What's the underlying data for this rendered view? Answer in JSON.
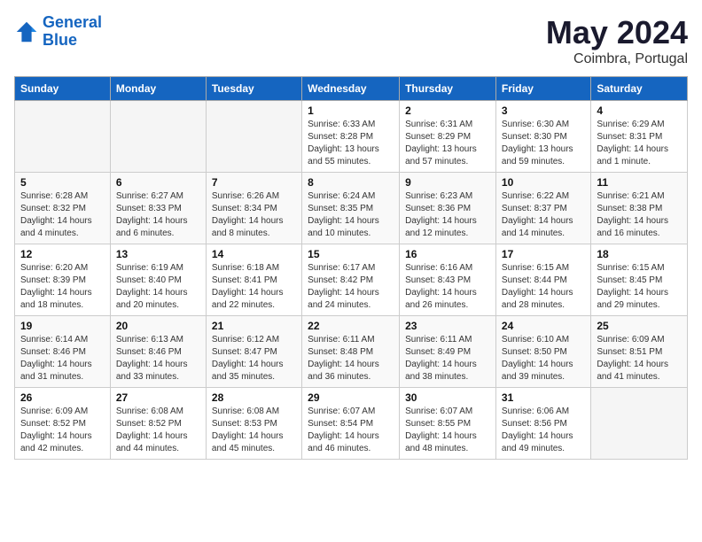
{
  "header": {
    "logo_line1": "General",
    "logo_line2": "Blue",
    "month_year": "May 2024",
    "location": "Coimbra, Portugal"
  },
  "weekdays": [
    "Sunday",
    "Monday",
    "Tuesday",
    "Wednesday",
    "Thursday",
    "Friday",
    "Saturday"
  ],
  "weeks": [
    [
      {
        "day": "",
        "info": ""
      },
      {
        "day": "",
        "info": ""
      },
      {
        "day": "",
        "info": ""
      },
      {
        "day": "1",
        "info": "Sunrise: 6:33 AM\nSunset: 8:28 PM\nDaylight: 13 hours\nand 55 minutes."
      },
      {
        "day": "2",
        "info": "Sunrise: 6:31 AM\nSunset: 8:29 PM\nDaylight: 13 hours\nand 57 minutes."
      },
      {
        "day": "3",
        "info": "Sunrise: 6:30 AM\nSunset: 8:30 PM\nDaylight: 13 hours\nand 59 minutes."
      },
      {
        "day": "4",
        "info": "Sunrise: 6:29 AM\nSunset: 8:31 PM\nDaylight: 14 hours\nand 1 minute."
      }
    ],
    [
      {
        "day": "5",
        "info": "Sunrise: 6:28 AM\nSunset: 8:32 PM\nDaylight: 14 hours\nand 4 minutes."
      },
      {
        "day": "6",
        "info": "Sunrise: 6:27 AM\nSunset: 8:33 PM\nDaylight: 14 hours\nand 6 minutes."
      },
      {
        "day": "7",
        "info": "Sunrise: 6:26 AM\nSunset: 8:34 PM\nDaylight: 14 hours\nand 8 minutes."
      },
      {
        "day": "8",
        "info": "Sunrise: 6:24 AM\nSunset: 8:35 PM\nDaylight: 14 hours\nand 10 minutes."
      },
      {
        "day": "9",
        "info": "Sunrise: 6:23 AM\nSunset: 8:36 PM\nDaylight: 14 hours\nand 12 minutes."
      },
      {
        "day": "10",
        "info": "Sunrise: 6:22 AM\nSunset: 8:37 PM\nDaylight: 14 hours\nand 14 minutes."
      },
      {
        "day": "11",
        "info": "Sunrise: 6:21 AM\nSunset: 8:38 PM\nDaylight: 14 hours\nand 16 minutes."
      }
    ],
    [
      {
        "day": "12",
        "info": "Sunrise: 6:20 AM\nSunset: 8:39 PM\nDaylight: 14 hours\nand 18 minutes."
      },
      {
        "day": "13",
        "info": "Sunrise: 6:19 AM\nSunset: 8:40 PM\nDaylight: 14 hours\nand 20 minutes."
      },
      {
        "day": "14",
        "info": "Sunrise: 6:18 AM\nSunset: 8:41 PM\nDaylight: 14 hours\nand 22 minutes."
      },
      {
        "day": "15",
        "info": "Sunrise: 6:17 AM\nSunset: 8:42 PM\nDaylight: 14 hours\nand 24 minutes."
      },
      {
        "day": "16",
        "info": "Sunrise: 6:16 AM\nSunset: 8:43 PM\nDaylight: 14 hours\nand 26 minutes."
      },
      {
        "day": "17",
        "info": "Sunrise: 6:15 AM\nSunset: 8:44 PM\nDaylight: 14 hours\nand 28 minutes."
      },
      {
        "day": "18",
        "info": "Sunrise: 6:15 AM\nSunset: 8:45 PM\nDaylight: 14 hours\nand 29 minutes."
      }
    ],
    [
      {
        "day": "19",
        "info": "Sunrise: 6:14 AM\nSunset: 8:46 PM\nDaylight: 14 hours\nand 31 minutes."
      },
      {
        "day": "20",
        "info": "Sunrise: 6:13 AM\nSunset: 8:46 PM\nDaylight: 14 hours\nand 33 minutes."
      },
      {
        "day": "21",
        "info": "Sunrise: 6:12 AM\nSunset: 8:47 PM\nDaylight: 14 hours\nand 35 minutes."
      },
      {
        "day": "22",
        "info": "Sunrise: 6:11 AM\nSunset: 8:48 PM\nDaylight: 14 hours\nand 36 minutes."
      },
      {
        "day": "23",
        "info": "Sunrise: 6:11 AM\nSunset: 8:49 PM\nDaylight: 14 hours\nand 38 minutes."
      },
      {
        "day": "24",
        "info": "Sunrise: 6:10 AM\nSunset: 8:50 PM\nDaylight: 14 hours\nand 39 minutes."
      },
      {
        "day": "25",
        "info": "Sunrise: 6:09 AM\nSunset: 8:51 PM\nDaylight: 14 hours\nand 41 minutes."
      }
    ],
    [
      {
        "day": "26",
        "info": "Sunrise: 6:09 AM\nSunset: 8:52 PM\nDaylight: 14 hours\nand 42 minutes."
      },
      {
        "day": "27",
        "info": "Sunrise: 6:08 AM\nSunset: 8:52 PM\nDaylight: 14 hours\nand 44 minutes."
      },
      {
        "day": "28",
        "info": "Sunrise: 6:08 AM\nSunset: 8:53 PM\nDaylight: 14 hours\nand 45 minutes."
      },
      {
        "day": "29",
        "info": "Sunrise: 6:07 AM\nSunset: 8:54 PM\nDaylight: 14 hours\nand 46 minutes."
      },
      {
        "day": "30",
        "info": "Sunrise: 6:07 AM\nSunset: 8:55 PM\nDaylight: 14 hours\nand 48 minutes."
      },
      {
        "day": "31",
        "info": "Sunrise: 6:06 AM\nSunset: 8:56 PM\nDaylight: 14 hours\nand 49 minutes."
      },
      {
        "day": "",
        "info": ""
      }
    ]
  ]
}
